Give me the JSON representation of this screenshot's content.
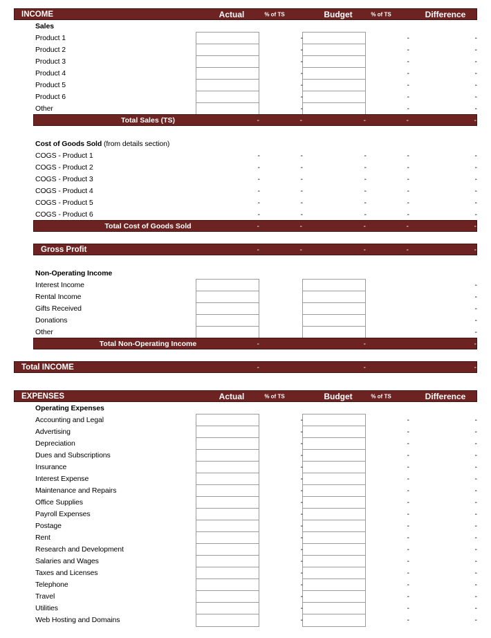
{
  "columns": {
    "actual": "Actual",
    "pct_of_ts_1": "% of TS",
    "budget": "Budget",
    "pct_of_ts_2": "% of TS",
    "difference": "Difference"
  },
  "colors": {
    "bar_background": "#6D2321",
    "bar_border": "#3F1412",
    "bar_text": "#FFFFFF",
    "input_border": "#9A9A9A",
    "page_background": "#FFFFFF",
    "body_text": "#000000"
  },
  "empty_value": "-",
  "income": {
    "section_title": "INCOME",
    "sales": {
      "group_label": "Sales",
      "items": [
        "Product 1",
        "Product 2",
        "Product 3",
        "Product 4",
        "Product 5",
        "Product 6",
        "Other"
      ],
      "total_label": "Total Sales  (TS)",
      "total_values": [
        "-",
        "-",
        "-",
        "-",
        "-"
      ]
    },
    "cogs": {
      "group_label": "Cost of Goods Sold",
      "group_note": "(from details section)",
      "items": [
        "COGS - Product 1",
        "COGS - Product 2",
        "COGS - Product 3",
        "COGS - Product 4",
        "COGS - Product 5",
        "COGS - Product 6"
      ],
      "row_values": [
        "-",
        "-",
        "-",
        "-",
        "-"
      ],
      "total_label": "Total Cost of Goods Sold",
      "total_values": [
        "-",
        "-",
        "-",
        "-",
        "-"
      ]
    },
    "gross_profit": {
      "label": "Gross Profit",
      "values": [
        "-",
        "-",
        "-",
        "-",
        "-"
      ]
    },
    "non_operating": {
      "group_label": "Non-Operating Income",
      "items": [
        "Interest Income",
        "Rental Income",
        "Gifts Received",
        "Donations",
        "Other"
      ],
      "total_label": "Total Non-Operating Income",
      "total_values": [
        "-",
        "-",
        "-"
      ]
    },
    "total": {
      "label": "Total INCOME",
      "values": [
        "-",
        "-",
        "-"
      ]
    }
  },
  "expenses": {
    "section_title": "EXPENSES",
    "operating": {
      "group_label": "Operating Expenses",
      "items": [
        "Accounting and Legal",
        "Advertising",
        "Depreciation",
        "Dues and Subscriptions",
        "Insurance",
        "Interest Expense",
        "Maintenance and Repairs",
        "Office Supplies",
        "Payroll Expenses",
        "Postage",
        "Rent",
        "Research and Development",
        "Salaries and Wages",
        "Taxes and Licenses",
        "Telephone",
        "Travel",
        "Utilities",
        "Web Hosting and Domains"
      ]
    }
  }
}
